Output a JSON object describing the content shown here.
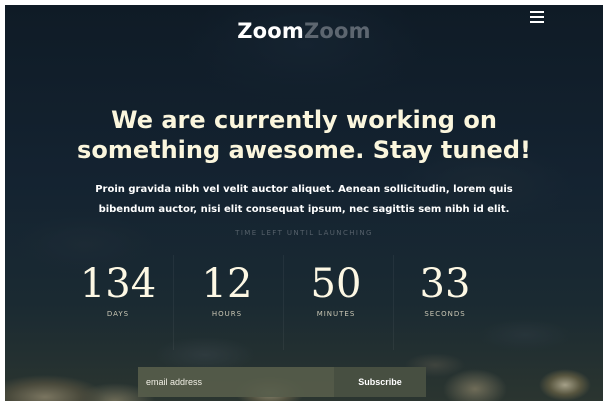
{
  "header": {
    "logo_part1": "Zoom",
    "logo_part2": "Zoom",
    "menu_icon": "hamburger-menu-icon"
  },
  "hero": {
    "headline_line1": "We are currently working on",
    "headline_line2": "something awesome. Stay tuned!",
    "sub_line1": "Proin gravida nibh vel velit auctor aliquet. Aenean sollicitudin, lorem quis",
    "sub_line2": "bibendum auctor, nisi elit consequat ipsum, nec sagittis sem nibh id elit."
  },
  "countdown": {
    "caption": "TIME LEFT UNTIL LAUNCHING",
    "units": [
      {
        "value": "134",
        "label": "DAYS"
      },
      {
        "value": "12",
        "label": "HOURS"
      },
      {
        "value": "50",
        "label": "MINUTES"
      },
      {
        "value": "33",
        "label": "SECONDS"
      }
    ]
  },
  "subscribe": {
    "placeholder": "email address",
    "button_label": "Subscribe"
  },
  "colors": {
    "logo_primary": "#ffffff",
    "logo_secondary": "#5d6670",
    "headline": "#fbf6dd"
  }
}
